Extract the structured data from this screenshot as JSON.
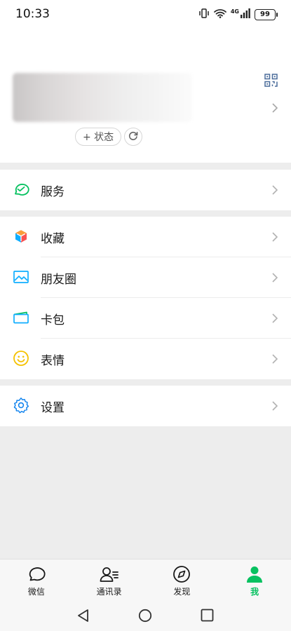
{
  "status_bar": {
    "time": "10:33",
    "network": "4G",
    "battery": "99"
  },
  "profile": {
    "status_label": "+ 状态"
  },
  "menu": {
    "service": {
      "label": "服务"
    },
    "favorites": {
      "label": "收藏"
    },
    "moments": {
      "label": "朋友圈"
    },
    "cards": {
      "label": "卡包"
    },
    "stickers": {
      "label": "表情"
    },
    "settings": {
      "label": "设置"
    }
  },
  "tabbar": {
    "chats": "微信",
    "contacts": "通讯录",
    "discover": "发现",
    "me": "我"
  },
  "colors": {
    "accent": "#07c160",
    "background": "#ededed",
    "settings_icon": "#1485ee",
    "stickers_icon": "#f5c200",
    "service_icon": "#07c160"
  },
  "icons": {
    "status_bar": [
      "vibrate-icon",
      "wifi-icon",
      "signal-icon",
      "battery-icon"
    ],
    "profile": [
      "qr-code-icon",
      "chevron-right-icon",
      "refresh-icon"
    ],
    "menu": [
      "service-icon",
      "favorites-icon",
      "moments-icon",
      "card-wallet-icon",
      "sticker-icon",
      "settings-gear-icon"
    ],
    "tabbar": [
      "chat-bubble-icon",
      "contacts-icon",
      "compass-icon",
      "person-icon"
    ],
    "navbar": [
      "back-icon",
      "home-icon",
      "recents-icon"
    ]
  }
}
